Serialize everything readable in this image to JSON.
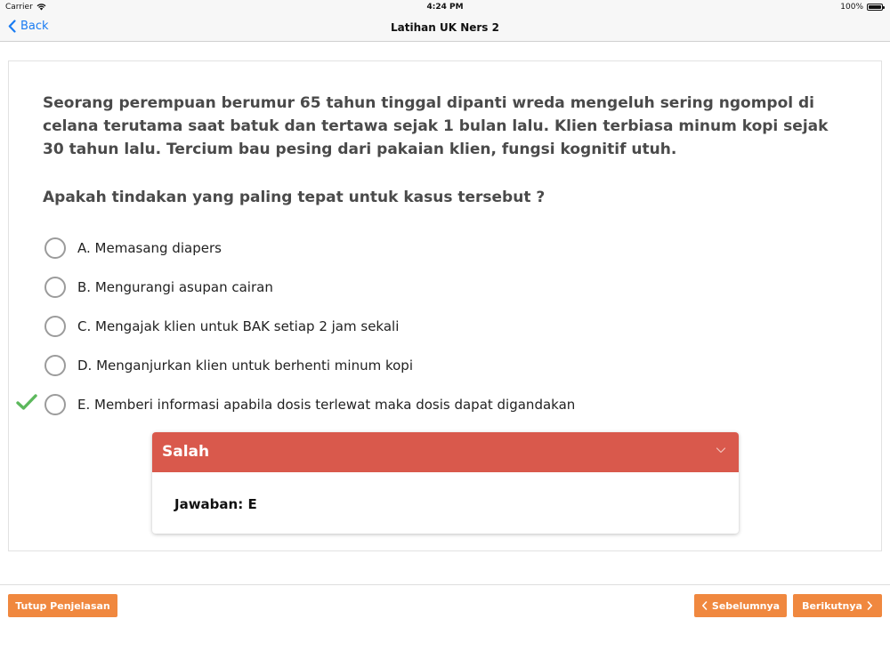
{
  "status_bar": {
    "carrier": "Carrier",
    "time": "4:24 PM",
    "battery": "100%"
  },
  "nav": {
    "back_label": "Back",
    "title": "Latihan UK Ners 2"
  },
  "question": {
    "text": "Seorang perempuan berumur 65 tahun tinggal dipanti wreda mengeluh sering ngompol di celana terutama saat batuk dan tertawa sejak 1 bulan lalu. Klien terbiasa minum kopi sejak 30 tahun lalu. Tercium bau pesing dari pakaian klien, fungsi kognitif utuh.",
    "prompt": "Apakah tindakan yang paling tepat untuk kasus tersebut ?"
  },
  "options": [
    {
      "label": "A. Memasang diapers"
    },
    {
      "label": "B. Mengurangi asupan cairan"
    },
    {
      "label": "C. Mengajak klien untuk BAK setiap 2 jam sekali"
    },
    {
      "label": "D. Menganjurkan klien untuk berhenti minum kopi"
    },
    {
      "label": "E. Memberi informasi apabila dosis terlewat maka dosis dapat digandakan"
    }
  ],
  "check_mark_option": "E",
  "feedback": {
    "status": "Salah",
    "answer": "Jawaban: E",
    "header_color": "#d9594c"
  },
  "buttons": {
    "close_explanation": "Tutup Penjelasan",
    "previous": "Sebelumnya",
    "next": "Berikutnya"
  },
  "colors": {
    "accent": "#f0883f",
    "link": "#1a7cf2",
    "check": "#5cb85c"
  }
}
